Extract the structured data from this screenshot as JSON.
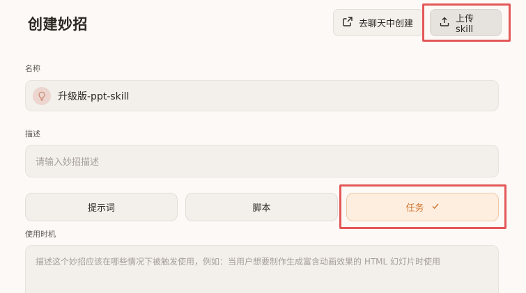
{
  "header": {
    "title": "创建妙招",
    "create_from_chat_label": "去聊天中创建",
    "upload_skill_label": "上传 skill"
  },
  "form": {
    "name": {
      "label": "名称",
      "value": "升级版-ppt-skill"
    },
    "description": {
      "label": "描述",
      "placeholder": "请输入妙招描述"
    },
    "tabs": [
      {
        "label": "提示词",
        "selected": false
      },
      {
        "label": "脚本",
        "selected": false
      },
      {
        "label": "任务",
        "selected": true
      }
    ],
    "usage": {
      "label": "使用时机",
      "placeholder": "描述这个妙招应该在哪些情况下被触发使用，例如：当用户想要制作生成富含动画效果的 HTML 幻灯片时使用"
    }
  },
  "colors": {
    "accent": "#d1762f",
    "highlight_box": "#e45757",
    "background": "#fcf9f6"
  },
  "icons": {
    "create_from_chat": "share-out-icon",
    "upload": "upload-icon",
    "name_avatar": "lightbulb-icon",
    "task_selected": "checkmark-icon"
  }
}
